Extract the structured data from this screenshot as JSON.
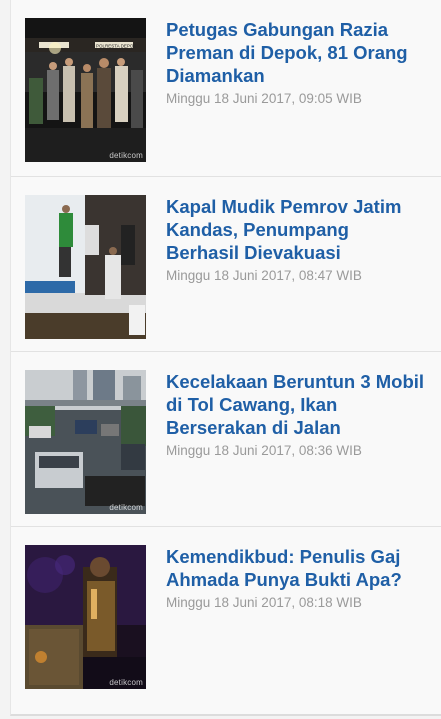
{
  "articles": [
    {
      "title": "Petugas Gabungan Razia Preman di Depok, 81 Orang Diamankan",
      "date": "Minggu 18 Juni 2017, 09:05 WIB",
      "image_watermark": "detikcom",
      "image_text": "POLRESTA DEPOK"
    },
    {
      "title": "Kapal Mudik Pemrov Jatim Kandas, Penumpang Berhasil Dievakuasi",
      "date": "Minggu 18 Juni 2017, 08:47 WIB"
    },
    {
      "title": "Kecelakaan Beruntun 3 Mobil di Tol Cawang, Ikan Berserakan di Jalan",
      "date": "Minggu 18 Juni 2017, 08:36 WIB",
      "image_watermark": "detikcom"
    },
    {
      "title": "Kemendikbud: Penulis Gaj Ahmada Punya Bukti Apa?",
      "date": "Minggu 18 Juni 2017, 08:18 WIB",
      "image_watermark": "detikcom"
    }
  ],
  "colors": {
    "title": "#1f5fa6",
    "date": "#9a9a9a",
    "background": "#f9f9f9"
  }
}
